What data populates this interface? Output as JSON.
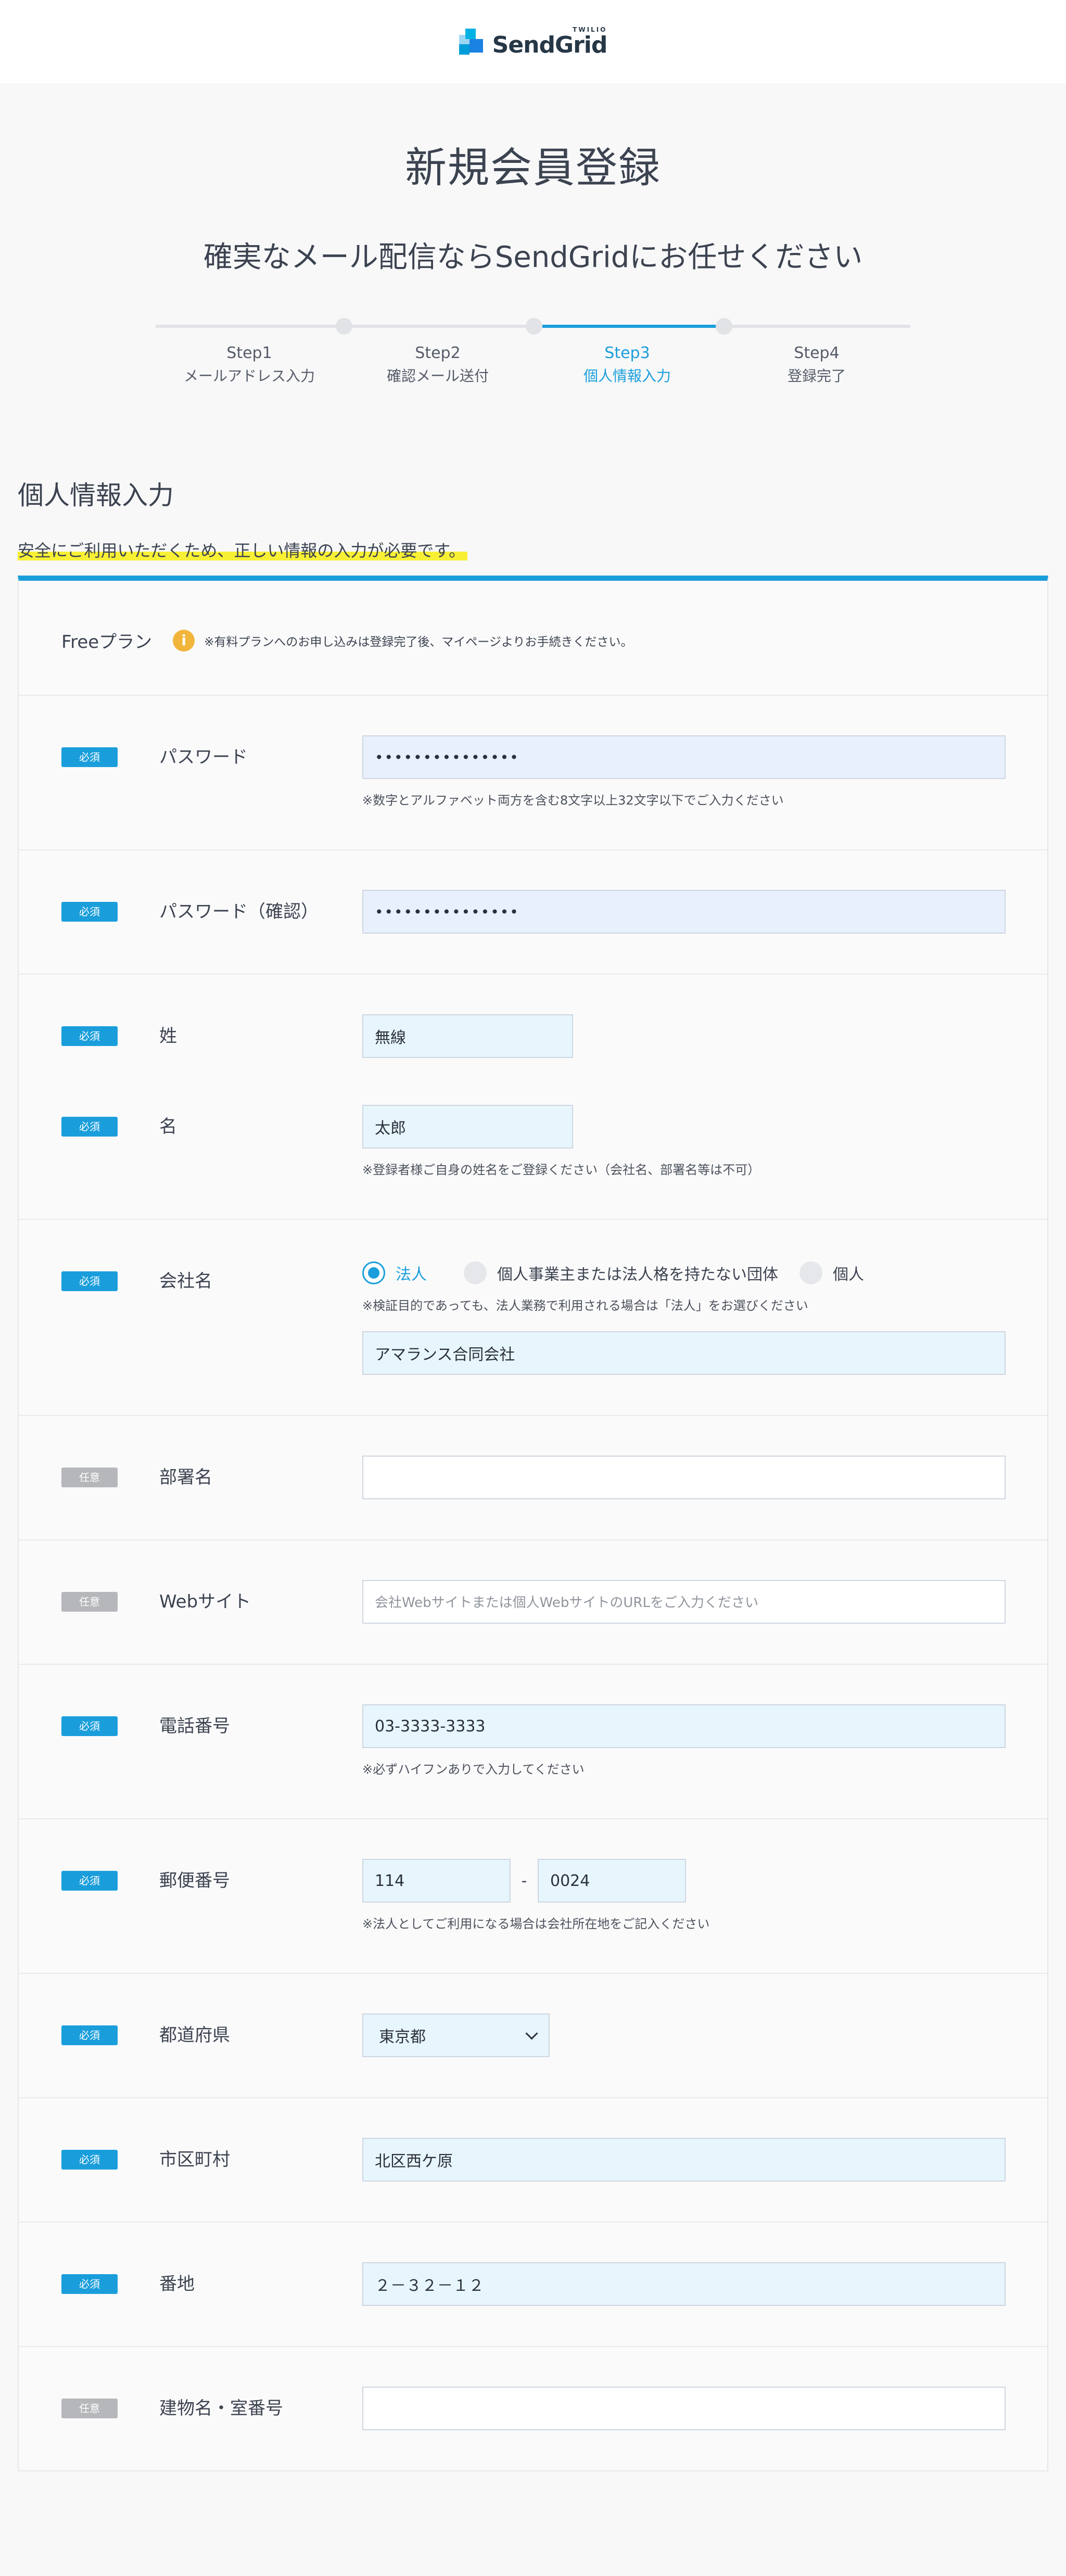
{
  "header": {
    "brand_top": "TWILIO",
    "brand_name": "SendGrid"
  },
  "hero": {
    "title": "新規会員登録",
    "subtitle": "確実なメール配信ならSendGridにお任せください"
  },
  "steps": [
    {
      "num": "Step1",
      "label": "メールアドレス入力"
    },
    {
      "num": "Step2",
      "label": "確認メール送付"
    },
    {
      "num": "Step3",
      "label": "個人情報入力"
    },
    {
      "num": "Step4",
      "label": "登録完了"
    }
  ],
  "active_step": 3,
  "section": {
    "title": "個人情報入力",
    "lead": "安全にご利用いただくため、正しい情報の入力が必要です。"
  },
  "plan": {
    "name": "Freeプラン",
    "icon_char": "i",
    "note": "※有料プランへのお申し込みは登録完了後、マイページよりお手続きください。"
  },
  "badges": {
    "required": "必須",
    "optional": "任意"
  },
  "form": {
    "password": {
      "label": "パスワード",
      "value": "•••••••••••••••",
      "note": "※数字とアルファベット両方を含む8文字以上32文字以下でご入力ください"
    },
    "password_confirm": {
      "label": "パスワード（確認）",
      "value": "•••••••••••••••"
    },
    "last_name": {
      "label": "姓",
      "value": "無線"
    },
    "first_name": {
      "label": "名",
      "value": "太郎",
      "note": "※登録者様ご自身の姓名をご登録ください（会社名、部署名等は不可）"
    },
    "company": {
      "label": "会社名",
      "options": [
        "法人",
        "個人事業主または法人格を持たない団体",
        "個人"
      ],
      "note": "※検証目的であっても、法人業務で利用される場合は「法人」をお選びください",
      "value": "アマランス合同会社"
    },
    "department": {
      "label": "部署名",
      "value": ""
    },
    "website": {
      "label": "Webサイト",
      "placeholder": "会社Webサイトまたは個人WebサイトのURLをご入力ください"
    },
    "phone": {
      "label": "電話番号",
      "value": "03-3333-3333",
      "note": "※必ずハイフンありで入力してください"
    },
    "zip": {
      "label": "郵便番号",
      "value1": "114",
      "separator": "-",
      "value2": "0024",
      "note": "※法人としてご利用になる場合は会社所在地をご記入ください"
    },
    "prefecture": {
      "label": "都道府県",
      "value": "東京都"
    },
    "city": {
      "label": "市区町村",
      "value": "北区西ケ原"
    },
    "address": {
      "label": "番地",
      "value": "２－３２－１２"
    },
    "building": {
      "label": "建物名・室番号",
      "value": ""
    }
  },
  "colors": {
    "accent": "#1a9edb",
    "highlight": "#f8f035",
    "required_badge": "#1a9edb",
    "optional_badge": "#b5b7bb",
    "info": "#f2b53b"
  }
}
